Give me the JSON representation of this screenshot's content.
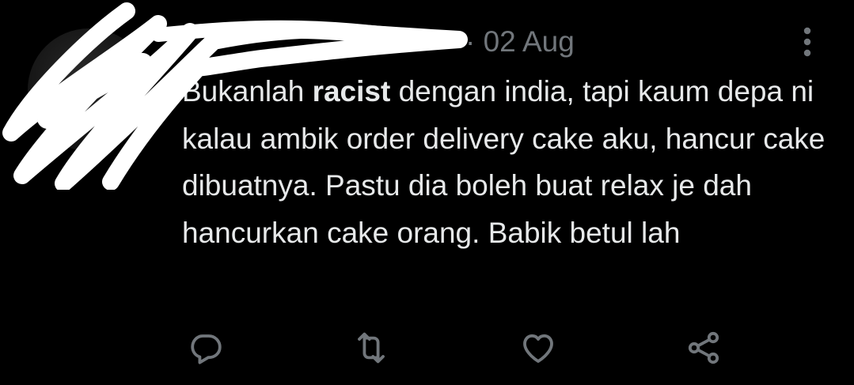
{
  "tweet": {
    "author_name": "",
    "separator": "·",
    "timestamp": "02 Aug",
    "text": {
      "before": "Bukanlah ",
      "bold": "racist",
      "after": " dengan india, tapi kaum depa ni kalau ambik order delivery cake aku, hancur cake dibuatnya. Pastu dia boleh buat relax je dah hancurkan cake orang. Babik betul lah"
    }
  },
  "icons": {
    "more": "more-vertical-icon",
    "reply": "reply-icon",
    "retweet": "retweet-icon",
    "like": "heart-icon",
    "share": "share-icon"
  },
  "colors": {
    "background": "#000000",
    "text": "#e7e9ea",
    "secondary": "#71767b",
    "redaction": "#ffffff"
  }
}
